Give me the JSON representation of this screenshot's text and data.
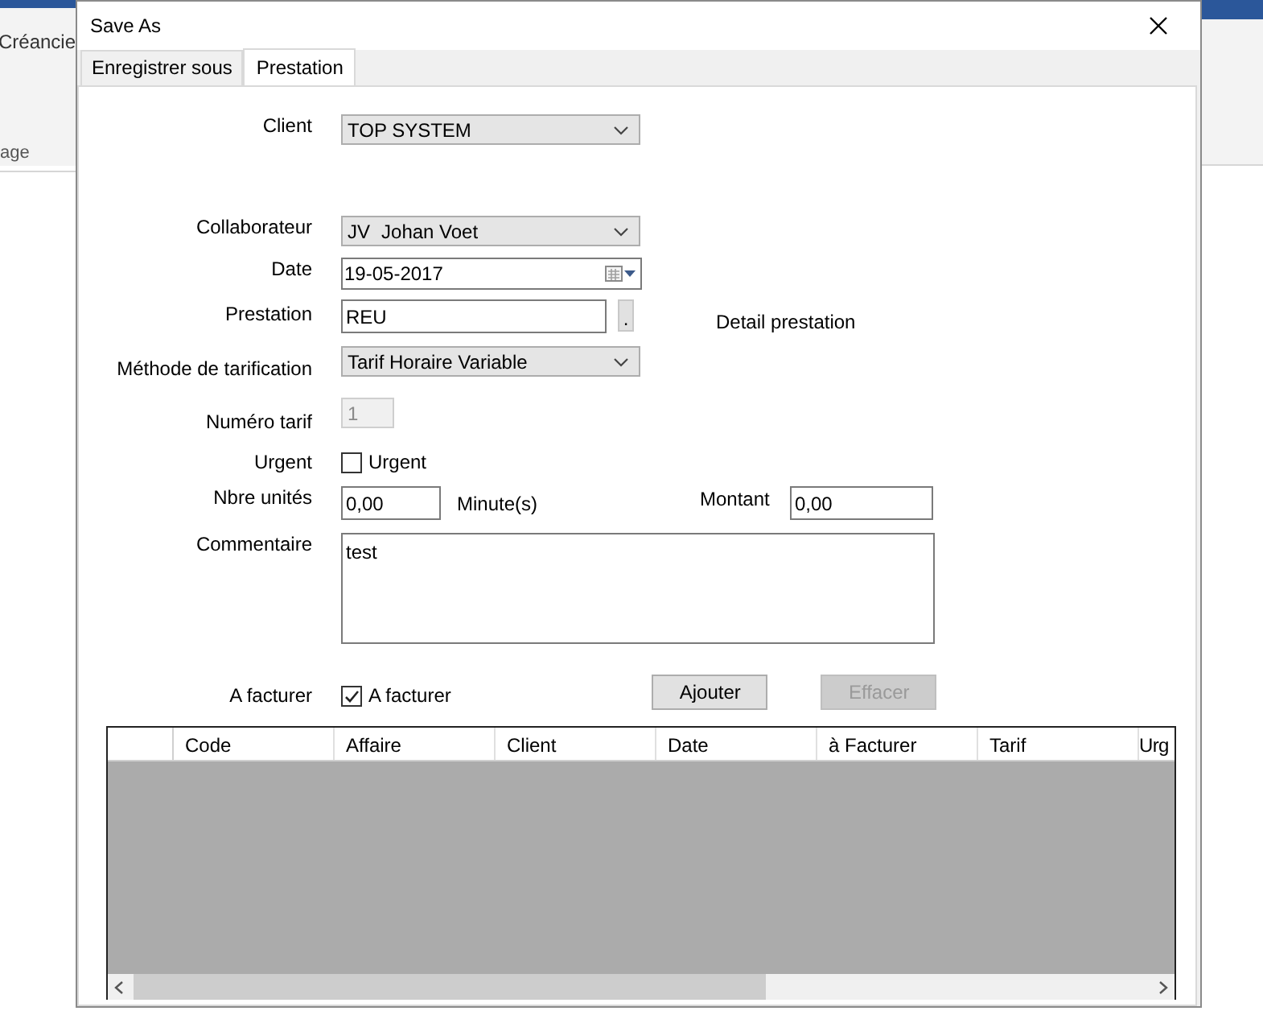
{
  "background_app": {
    "menu_label": "Créancie",
    "group_label": "age"
  },
  "dialog": {
    "title": "Save As",
    "tabs": [
      {
        "label": "Enregistrer sous",
        "selected": false
      },
      {
        "label": "Prestation",
        "selected": true
      }
    ],
    "form": {
      "client": {
        "label": "Client",
        "value": "TOP SYSTEM"
      },
      "collaborateur": {
        "label": "Collaborateur",
        "code": "JV",
        "value": "Johan Voet"
      },
      "date": {
        "label": "Date",
        "value": "19-05-2017"
      },
      "prestation": {
        "label": "Prestation",
        "value": "REU",
        "button": ".",
        "detail": "Detail prestation"
      },
      "methode": {
        "label": "Méthode de tarification",
        "value": "Tarif Horaire Variable"
      },
      "numero_tarif": {
        "label": "Numéro tarif",
        "value": "1",
        "disabled": true
      },
      "urgent": {
        "label": "Urgent",
        "checkbox_label": "Urgent",
        "checked": false
      },
      "nbre_unites": {
        "label": "Nbre unités",
        "value": "0,00",
        "unit": "Minute(s)"
      },
      "montant": {
        "label": "Montant",
        "value": "0,00"
      },
      "commentaire": {
        "label": "Commentaire",
        "value": "test"
      },
      "a_facturer": {
        "label": "A facturer",
        "checkbox_label": "A facturer",
        "checked": true
      }
    },
    "buttons": [
      {
        "label": "Ajouter",
        "disabled": false
      },
      {
        "label": "Effacer",
        "disabled": true
      }
    ],
    "grid": {
      "columns": [
        "Code",
        "Affaire",
        "Client",
        "Date",
        "à Facturer",
        "Tarif",
        "Urg"
      ]
    }
  }
}
